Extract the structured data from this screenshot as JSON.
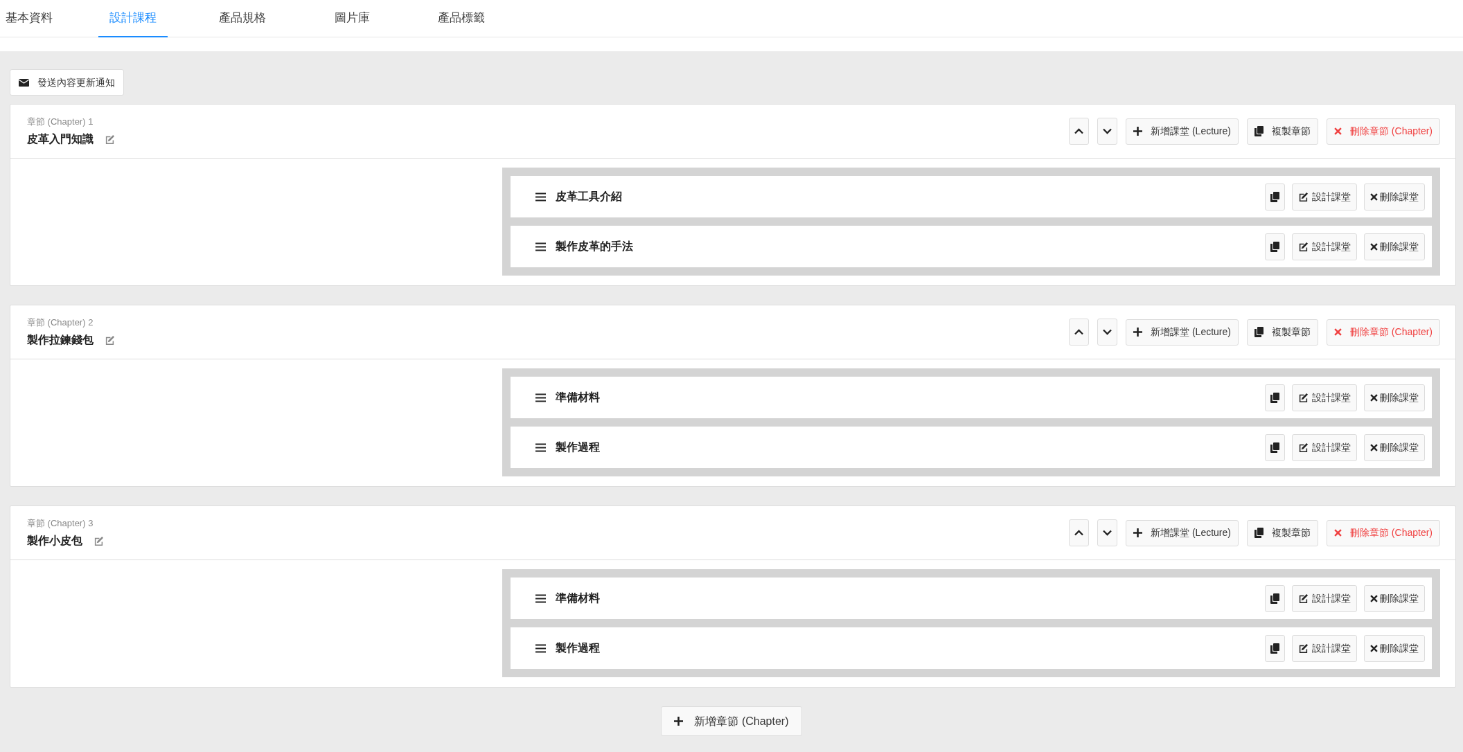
{
  "tabs": [
    {
      "label": "基本資料",
      "selected": false
    },
    {
      "label": "設計課程",
      "selected": true
    },
    {
      "label": "產品規格",
      "selected": false
    },
    {
      "label": "圖片庫",
      "selected": false
    },
    {
      "label": "產品標籤",
      "selected": false
    }
  ],
  "notify_button": "發送內容更新通知",
  "chapters": [
    {
      "label": "章節 (Chapter) 1",
      "title": "皮革入門知識",
      "add_lecture": "新增課堂 (Lecture)",
      "copy": "複製章節",
      "delete": "刪除章節 (Chapter)",
      "lectures": [
        {
          "title": "皮革工具介紹",
          "design": "設計課堂",
          "delete": "刪除課堂"
        },
        {
          "title": "製作皮革的手法",
          "design": "設計課堂",
          "delete": "刪除課堂"
        }
      ]
    },
    {
      "label": "章節 (Chapter) 2",
      "title": "製作拉鍊錢包",
      "add_lecture": "新增課堂 (Lecture)",
      "copy": "複製章節",
      "delete": "刪除章節 (Chapter)",
      "lectures": [
        {
          "title": "準備材料",
          "design": "設計課堂",
          "delete": "刪除課堂"
        },
        {
          "title": "製作過程",
          "design": "設計課堂",
          "delete": "刪除課堂"
        }
      ]
    },
    {
      "label": "章節 (Chapter) 3",
      "title": "製作小皮包",
      "add_lecture": "新增課堂 (Lecture)",
      "copy": "複製章節",
      "delete": "刪除章節 (Chapter)",
      "lectures": [
        {
          "title": "準備材料",
          "design": "設計課堂",
          "delete": "刪除課堂"
        },
        {
          "title": "製作過程",
          "design": "設計課堂",
          "delete": "刪除課堂"
        }
      ]
    }
  ],
  "add_chapter_button": "新增章節 (Chapter)"
}
